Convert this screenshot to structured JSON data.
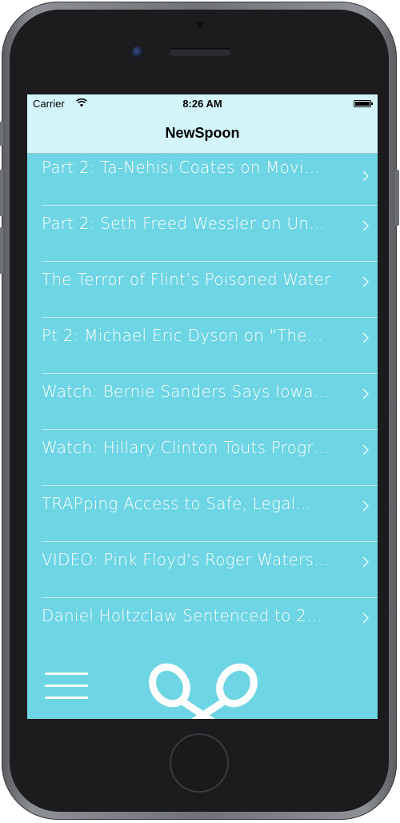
{
  "status_bar": {
    "carrier": "Carrier",
    "time": "8:26 AM"
  },
  "nav": {
    "title": "NewSpoon"
  },
  "articles": [
    {
      "title": "Part 2: Ta-Nehisi Coates on Movi…"
    },
    {
      "title": "Part 2: Seth Freed Wessler on Un…"
    },
    {
      "title": "The Terror of Flint’s Poisoned Water"
    },
    {
      "title": "Pt 2: Michael Eric Dyson on \"The…"
    },
    {
      "title": "Watch: Bernie Sanders Says Iowa…"
    },
    {
      "title": "Watch: Hillary Clinton Touts Progr…"
    },
    {
      "title": "TRAPping Access to Safe, Legal…"
    },
    {
      "title": "VIDEO: Pink Floyd's Roger Waters…"
    },
    {
      "title": "Daniel Holtzclaw Sentenced to 2…"
    }
  ],
  "icons": {
    "row_disclosure": "chevron-right-icon",
    "menu": "hamburger-menu-icon",
    "logo": "crossed-spoons-icon"
  },
  "colors": {
    "list_background": "#6dd5e3",
    "bar_background": "#d3f5fa",
    "text": "#ffffff"
  }
}
